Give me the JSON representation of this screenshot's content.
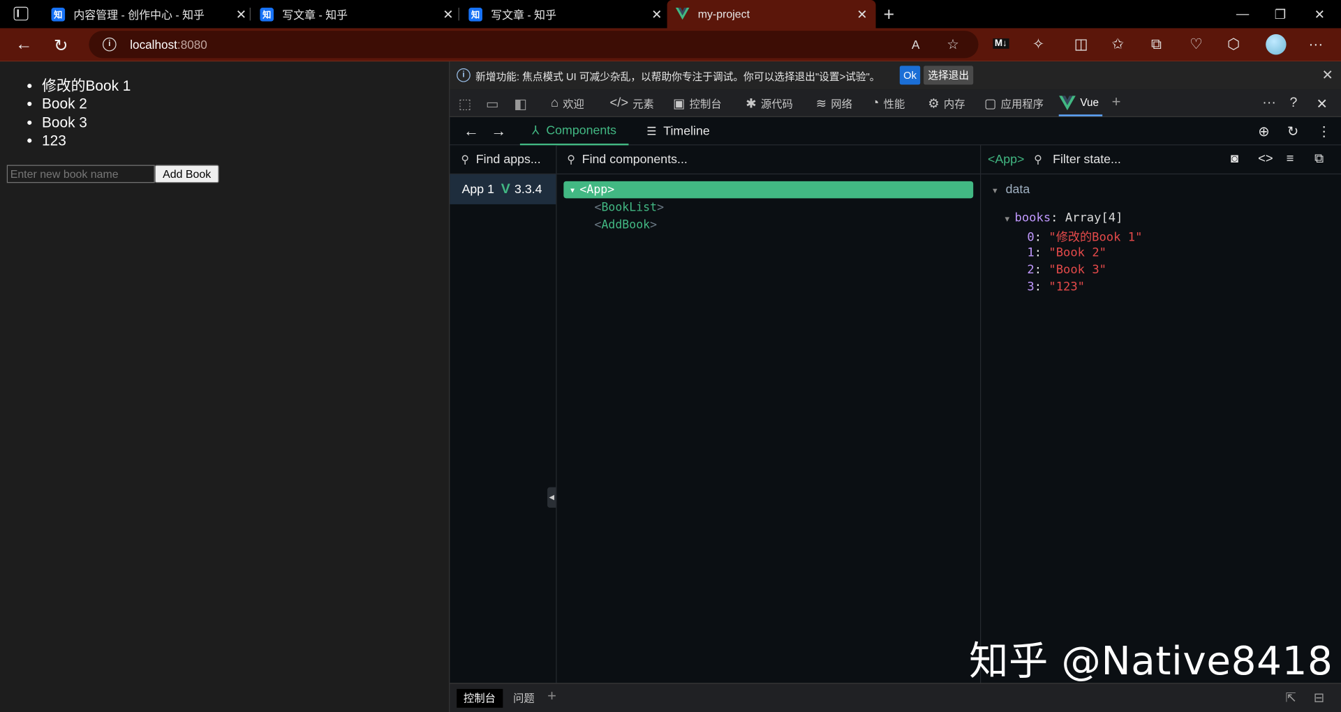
{
  "browser": {
    "tabs": [
      {
        "favicon": "知",
        "title": "内容管理 - 创作中心 - 知乎"
      },
      {
        "favicon": "知",
        "title": "写文章 - 知乎"
      },
      {
        "favicon": "知",
        "title": "写文章 - 知乎"
      },
      {
        "favicon": "V",
        "title": "my-project"
      }
    ],
    "url_host": "localhost",
    "url_port": ":8080",
    "accent": "#5b160a"
  },
  "page": {
    "books": [
      "修改的Book 1",
      "Book 2",
      "Book 3",
      "123"
    ],
    "input_placeholder": "Enter new book name",
    "add_button": "Add Book"
  },
  "devtools": {
    "banner": {
      "message": "新增功能: 焦点模式 UI 可减少杂乱，以帮助你专注于调试。你可以选择退出\"设置>试验\"。",
      "ok": "Ok",
      "optout": "选择退出"
    },
    "tabs": [
      {
        "icon": "home-icon",
        "label": "欢迎"
      },
      {
        "icon": "code-icon",
        "label": "元素"
      },
      {
        "icon": "console-icon",
        "label": "控制台"
      },
      {
        "icon": "bug-icon",
        "label": "源代码"
      },
      {
        "icon": "wifi-icon",
        "label": "网络"
      },
      {
        "icon": "gauge-icon",
        "label": "性能"
      },
      {
        "icon": "memory-icon",
        "label": "内存"
      },
      {
        "icon": "window-icon",
        "label": "应用程序"
      },
      {
        "icon": "vue-icon",
        "label": "Vue"
      }
    ],
    "drawer": {
      "console": "控制台",
      "issues": "问题"
    }
  },
  "vue": {
    "nav": {
      "components": "Components",
      "timeline": "Timeline"
    },
    "apps_search_placeholder": "Find apps...",
    "app": {
      "name": "App 1",
      "version": "3.3.4"
    },
    "components_search_placeholder": "Find components...",
    "tree": {
      "root": "<App>",
      "children": [
        {
          "open": "<",
          "name": "BookList",
          "close": ">"
        },
        {
          "open": "<",
          "name": "AddBook",
          "close": ">"
        }
      ]
    },
    "state": {
      "selected": "<App>",
      "filter_placeholder": "Filter state...",
      "section": "data",
      "prop_name": "books",
      "prop_type": "Array[4]",
      "items": [
        {
          "index": "0",
          "value": "\"修改的Book 1\""
        },
        {
          "index": "1",
          "value": "\"Book 2\""
        },
        {
          "index": "2",
          "value": "\"Book 3\""
        },
        {
          "index": "3",
          "value": "\"123\""
        }
      ]
    },
    "accent": "#42b883"
  },
  "watermark": "知乎 @Native8418"
}
